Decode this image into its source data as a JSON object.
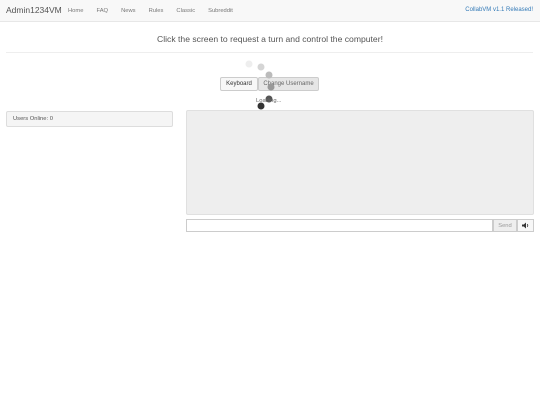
{
  "navbar": {
    "brand": "Admin1234VM",
    "links": [
      "Home",
      "FAQ",
      "News",
      "Rules",
      "Classic",
      "Subreddit"
    ],
    "release": "CollabVM v1.1 Released!"
  },
  "main": {
    "headline": "Click the screen to request a turn and control the computer!",
    "keyboard_label": "Keyboard",
    "change_username_label": "Change Username",
    "loading_text": "Loading..."
  },
  "sidebar": {
    "users_online": "Users Online: 0"
  },
  "chat": {
    "send_label": "Send",
    "input_value": "",
    "volume_icon": "volume-icon"
  }
}
